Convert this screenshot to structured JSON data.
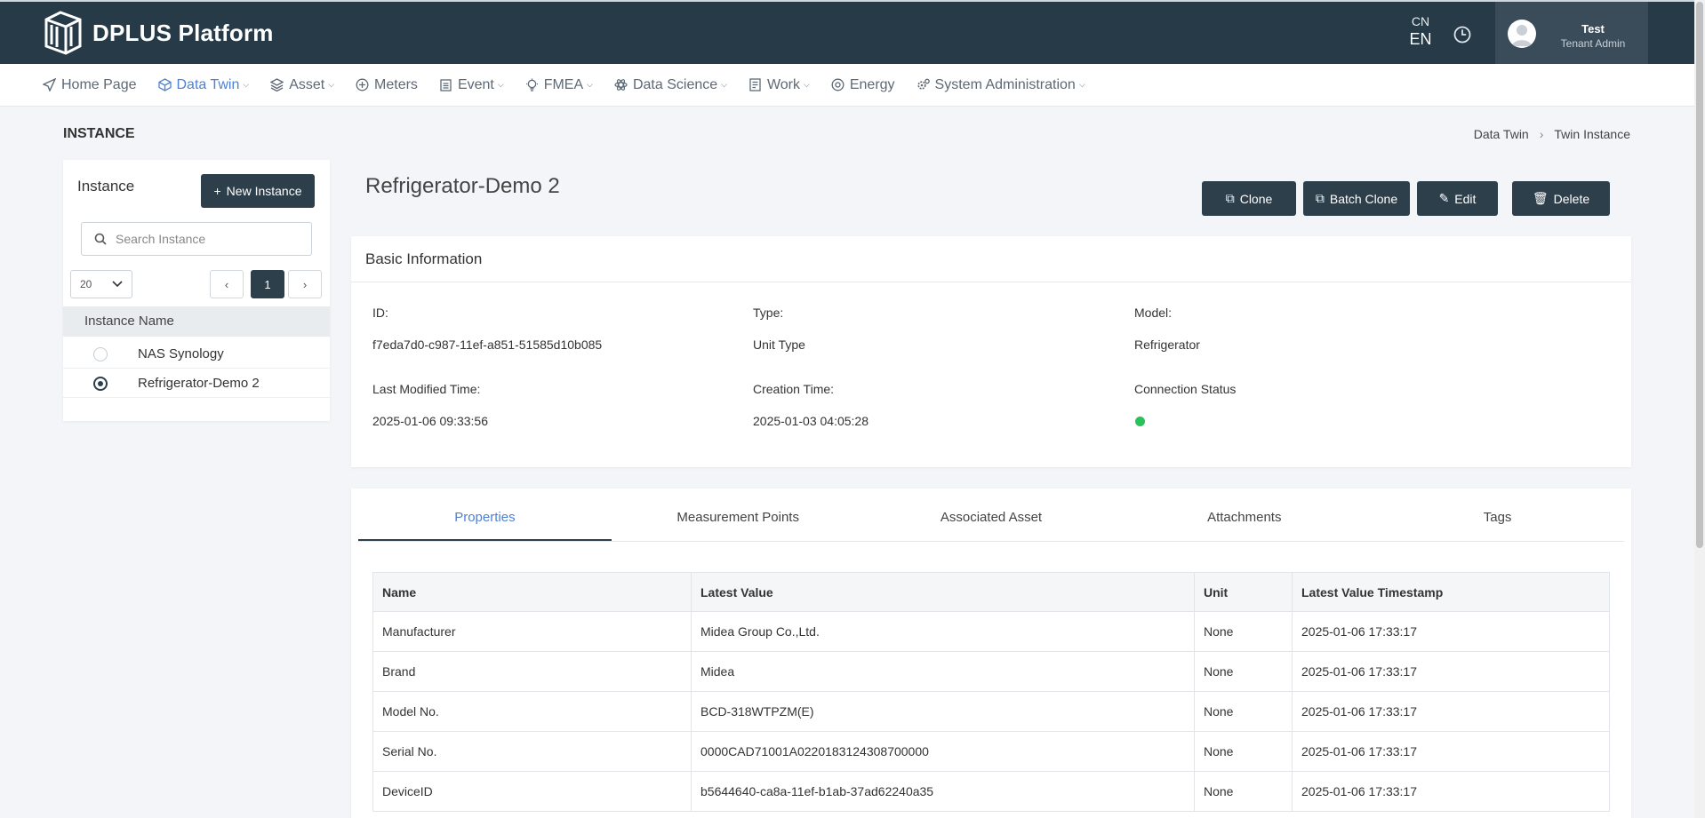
{
  "app": {
    "name": "DPLUS Platform"
  },
  "header": {
    "lang_cn": "CN",
    "lang_en": "EN",
    "user_name": "Test",
    "user_role": "Tenant Admin"
  },
  "nav": {
    "items": [
      {
        "label": "Home Page",
        "icon": "send-icon",
        "caret": false,
        "active": false
      },
      {
        "label": "Data Twin",
        "icon": "cube-icon",
        "caret": true,
        "active": true
      },
      {
        "label": "Asset",
        "icon": "layers-icon",
        "caret": true,
        "active": false
      },
      {
        "label": "Meters",
        "icon": "plus-circle-icon",
        "caret": false,
        "active": false
      },
      {
        "label": "Event",
        "icon": "clipboard-icon",
        "caret": true,
        "active": false
      },
      {
        "label": "FMEA",
        "icon": "bulb-icon",
        "caret": true,
        "active": false
      },
      {
        "label": "Data Science",
        "icon": "atom-icon",
        "caret": true,
        "active": false
      },
      {
        "label": "Work",
        "icon": "document-icon",
        "caret": true,
        "active": false
      },
      {
        "label": "Energy",
        "icon": "energy-icon",
        "caret": false,
        "active": false
      },
      {
        "label": "System Administration",
        "icon": "gears-icon",
        "caret": true,
        "active": false
      }
    ]
  },
  "page": {
    "title": "INSTANCE",
    "breadcrumb": [
      "Data Twin",
      "Twin Instance"
    ]
  },
  "sidebar": {
    "title": "Instance",
    "new_button": "New Instance",
    "search_placeholder": "Search Instance",
    "page_size": "20",
    "current_page": "1",
    "prev": "‹",
    "next": "›",
    "column": "Instance Name",
    "items": [
      {
        "name": "NAS Synology",
        "selected": false
      },
      {
        "name": "Refrigerator-Demo 2",
        "selected": true
      }
    ]
  },
  "instance": {
    "title": "Refrigerator-Demo 2",
    "actions": {
      "clone": "Clone",
      "batch_clone": "Batch Clone",
      "edit": "Edit",
      "delete": "Delete"
    }
  },
  "basic_info": {
    "title": "Basic Information",
    "id_label": "ID:",
    "id_value": "f7eda7d0-c987-11ef-a851-51585d10b085",
    "type_label": "Type:",
    "type_value": "Unit Type",
    "model_label": "Model:",
    "model_value": "Refrigerator",
    "modified_label": "Last Modified Time:",
    "modified_value": "2025-01-06 09:33:56",
    "created_label": "Creation Time:",
    "created_value": "2025-01-03 04:05:28",
    "conn_label": "Connection Status",
    "conn_color": "#27c35a"
  },
  "tabs": [
    "Properties",
    "Measurement Points",
    "Associated Asset",
    "Attachments",
    "Tags"
  ],
  "properties": {
    "headers": [
      "Name",
      "Latest Value",
      "Unit",
      "Latest Value Timestamp"
    ],
    "rows": [
      [
        "Manufacturer",
        "Midea Group Co.,Ltd.",
        "None",
        "2025-01-06 17:33:17"
      ],
      [
        "Brand",
        "Midea",
        "None",
        "2025-01-06 17:33:17"
      ],
      [
        "Model No.",
        "BCD-318WTPZM(E)",
        "None",
        "2025-01-06 17:33:17"
      ],
      [
        "Serial No.",
        "0000CAD71001A0220183124308700000",
        "None",
        "2025-01-06 17:33:17"
      ],
      [
        "DeviceID",
        "b5644640-ca8a-11ef-b1ab-37ad62240a35",
        "None",
        "2025-01-06 17:33:17"
      ]
    ]
  }
}
